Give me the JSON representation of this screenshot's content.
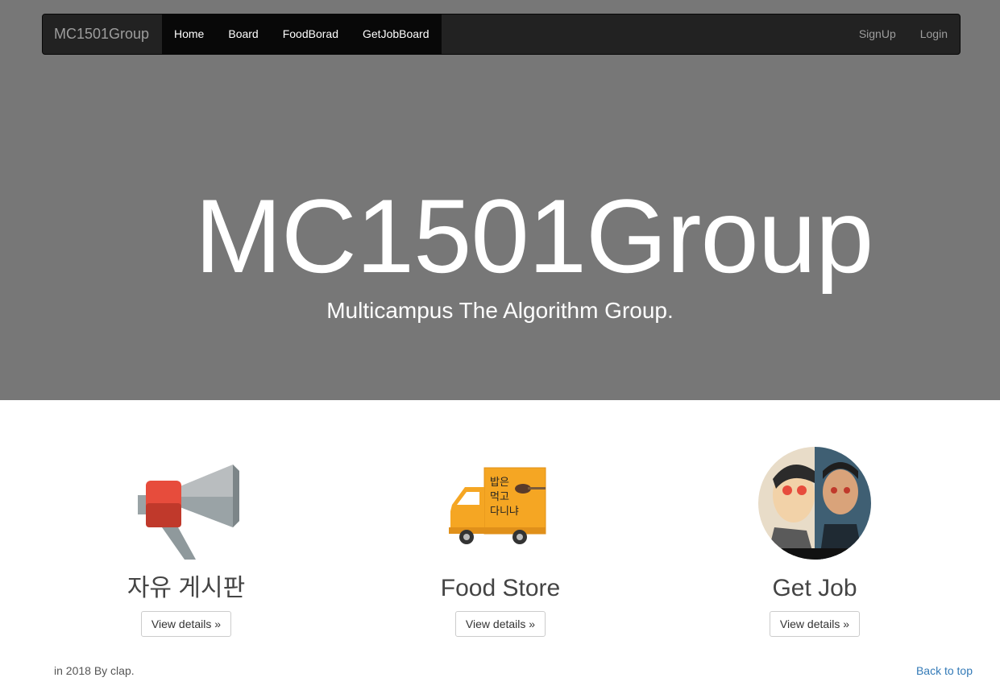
{
  "navbar": {
    "brand": "MC1501Group",
    "left_items": [
      "Home",
      "Board",
      "FoodBorad",
      "GetJobBoard"
    ],
    "right_items": [
      "SignUp",
      "Login"
    ]
  },
  "hero": {
    "title": "MC1501Group",
    "subtitle": "Multicampus The Algorithm Group."
  },
  "cards": [
    {
      "title": "자유 게시판",
      "button": "View details »",
      "icon": "megaphone-icon"
    },
    {
      "title": "Food Store",
      "button": "View details »",
      "icon": "food-truck-image"
    },
    {
      "title": "Get Job",
      "button": "View details »",
      "icon": "job-avatar-image"
    }
  ],
  "footer": {
    "left": "in 2018 By clap.",
    "right": "Back to top"
  },
  "colors": {
    "hero_bg": "#777777",
    "navbar_bg": "#222222",
    "link": "#337ab7"
  }
}
